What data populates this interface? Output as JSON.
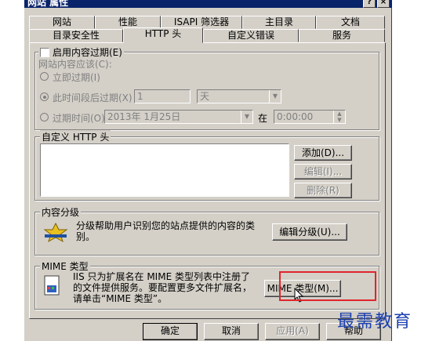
{
  "window": {
    "title": "网站 属性",
    "help_btn": "?",
    "close_btn": "×"
  },
  "tabs_row1": [
    "网站",
    "性能",
    "ISAPI 筛选器",
    "主目录",
    "文档"
  ],
  "tabs_row2": [
    "目录安全性",
    "HTTP 头",
    "自定义错误",
    "服务"
  ],
  "expire": {
    "checkbox_label": "启用内容过期(E)",
    "should_label": "网站内容应该(C):",
    "opt_immediate": "立即过期(I)",
    "opt_after": "此时间段后过期(X)",
    "after_value": "1",
    "after_unit": "天",
    "opt_on": "过期时间(O)",
    "date_value": "2013年 1月25日",
    "at_label": "在",
    "time_value": "0:00:00"
  },
  "custom_headers": {
    "legend": "自定义 HTTP 头",
    "add": "添加(D)...",
    "edit": "编辑(I)...",
    "delete": "删除(R)"
  },
  "rating": {
    "legend": "内容分级",
    "description": "分级帮助用户识别您的站点提供的内容的类别。",
    "edit_button": "编辑分级(U)..."
  },
  "mime": {
    "legend": "MIME 类型",
    "description": "IIS 只为扩展名在 MIME 类型列表中注册了的文件提供服务。要配置更多文件扩展名，请单击“MIME 类型”。",
    "button": "MIME 类型(M)..."
  },
  "footer": {
    "ok": "确定",
    "cancel": "取消",
    "apply": "应用(A)",
    "help": "帮助"
  },
  "watermark": "最需教育"
}
